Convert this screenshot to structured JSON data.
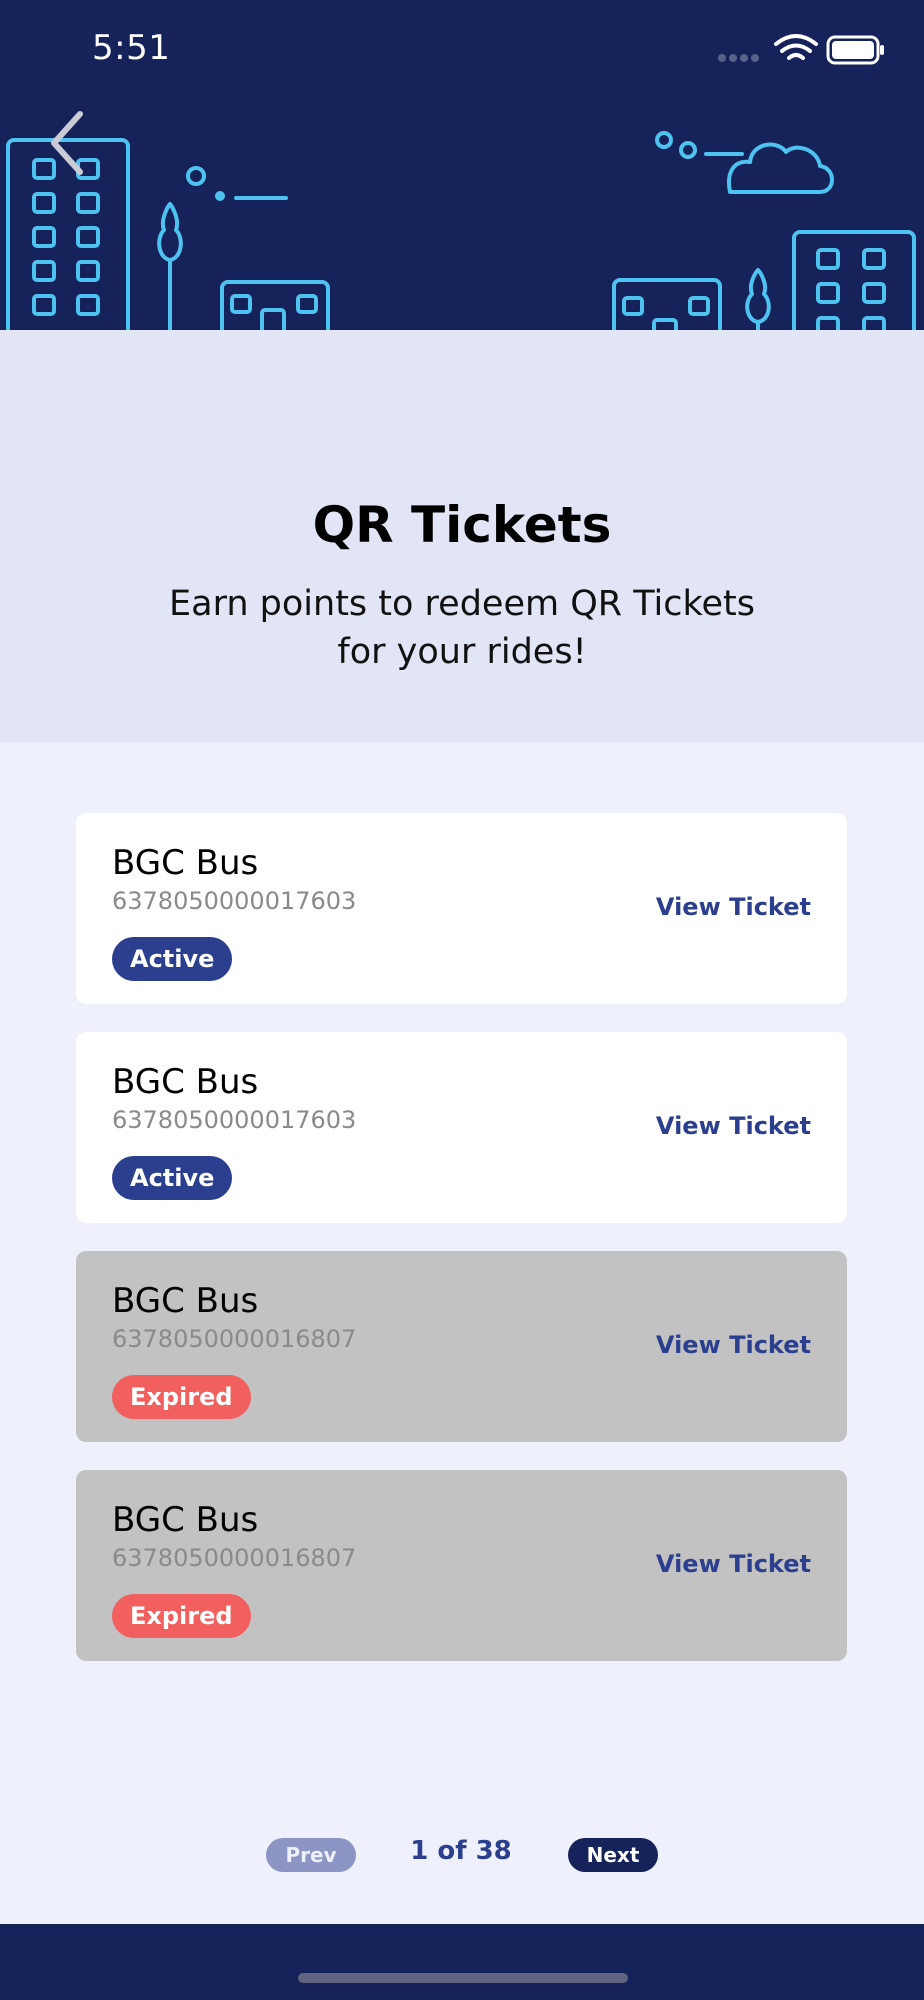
{
  "status_bar": {
    "time": "5:51"
  },
  "header": {
    "back_icon": "chevron-left-icon"
  },
  "hero": {
    "title": "QR Tickets",
    "subtitle_line1": "Earn points to redeem QR Tickets",
    "subtitle_line2": "for your rides!"
  },
  "tickets": [
    {
      "name": "BGC Bus",
      "number": "6378050000017603",
      "status": "Active",
      "action": "View Ticket"
    },
    {
      "name": "BGC Bus",
      "number": "6378050000017603",
      "status": "Active",
      "action": "View Ticket"
    },
    {
      "name": "BGC Bus",
      "number": "6378050000016807",
      "status": "Expired",
      "action": "View Ticket"
    },
    {
      "name": "BGC Bus",
      "number": "6378050000016807",
      "status": "Expired",
      "action": "View Ticket"
    }
  ],
  "pagination": {
    "prev": "Prev",
    "page_info": "1 of 38",
    "next": "Next"
  },
  "colors": {
    "header_bg": "#16225a",
    "accent": "#2b3f8e",
    "expired": "#f25f5f",
    "illustration": "#4fc3f0"
  }
}
